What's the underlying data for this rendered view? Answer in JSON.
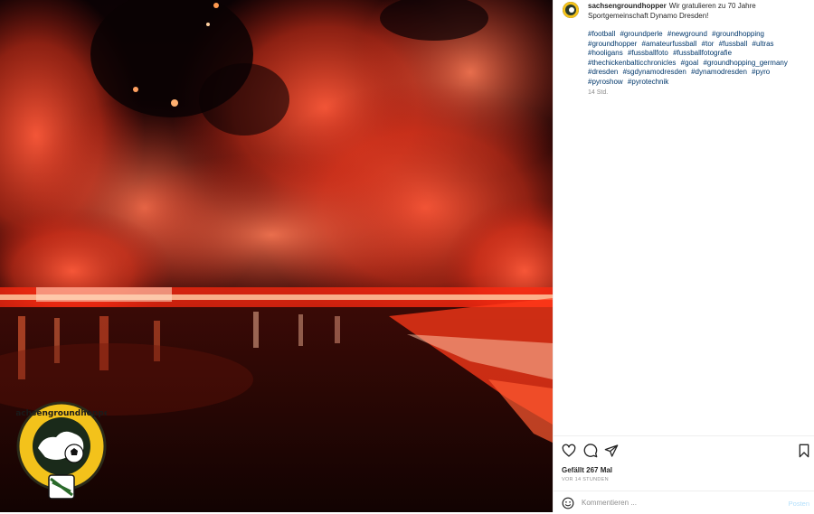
{
  "post": {
    "username": "sachsengroundhopper",
    "caption": "Wir gratulieren zu 70 Jahre Sportgemeinschaft Dynamo Dresden!",
    "hashtags": [
      "#football",
      "#groundperle",
      "#newground",
      "#groundhopping",
      "#groundhopper",
      "#amateurfussball",
      "#tor",
      "#fussball",
      "#ultras",
      "#hooligans",
      "#fussballfoto",
      "#fussballfotografie",
      "#thechickenbalticchronicles",
      "#goal",
      "#groundhopping_germany",
      "#dresden",
      "#sgdynamodresden",
      "#dynamodresden",
      "#pyro",
      "#pyroshow",
      "#pyrotechnik"
    ],
    "age": "14 Std.",
    "likes": "Gefällt 267 Mal",
    "time_ago": "VOR 14 STUNDEN"
  },
  "media": {
    "logo_text": "Sachsengroundhopper",
    "icon": "pyro-stadium-photo"
  },
  "actions": {
    "like_icon": "heart-icon",
    "comment_icon": "comment-icon",
    "share_icon": "share-icon",
    "save_icon": "bookmark-icon"
  },
  "comment_box": {
    "placeholder": "Kommentieren ...",
    "post_label": "Posten",
    "emoji_icon": "emoji-icon"
  },
  "colors": {
    "link": "#00376b",
    "muted": "#8e8e8e",
    "post_disabled": "#b2dffc",
    "flare": "#ff3a1a"
  }
}
